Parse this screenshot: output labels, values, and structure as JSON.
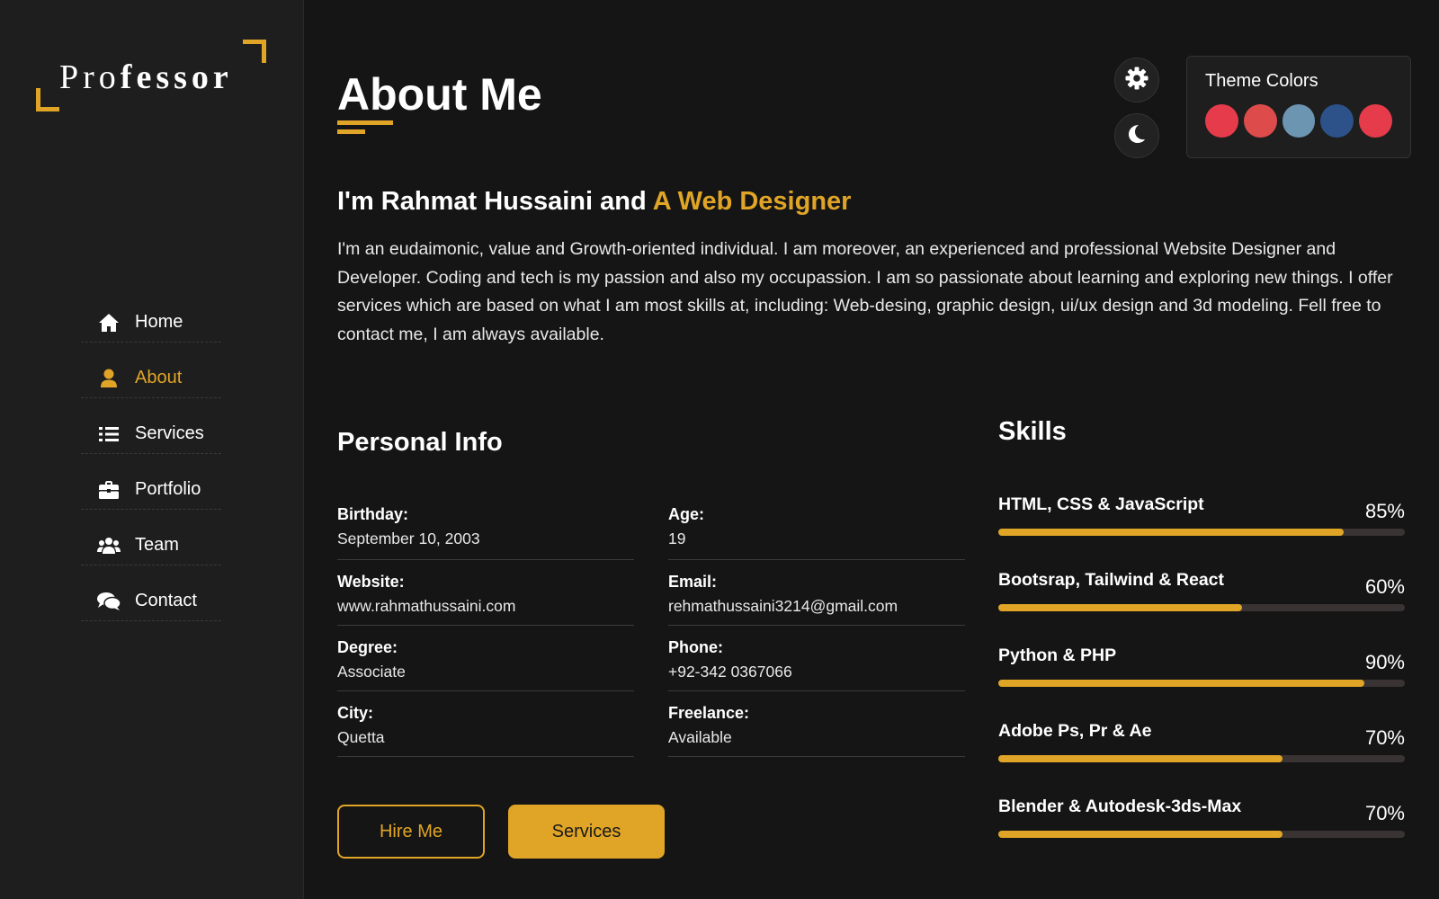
{
  "brand": {
    "logo_light": "Pro",
    "logo_bold": "fessor"
  },
  "nav": [
    {
      "label": "Home",
      "icon": "home-icon",
      "active": false
    },
    {
      "label": "About",
      "icon": "user-icon",
      "active": true
    },
    {
      "label": "Services",
      "icon": "list-icon",
      "active": false
    },
    {
      "label": "Portfolio",
      "icon": "briefcase-icon",
      "active": false
    },
    {
      "label": "Team",
      "icon": "users-icon",
      "active": false
    },
    {
      "label": "Contact",
      "icon": "comments-icon",
      "active": false
    }
  ],
  "header": {
    "title": "About Me"
  },
  "theme": {
    "title": "Theme Colors",
    "swatches": [
      "#e63b4b",
      "#dd4b4b",
      "#6c95b2",
      "#2c5289",
      "#e63b4b"
    ],
    "accent": "#e0a526"
  },
  "intro": {
    "title_prefix": "I'm Rahmat Hussaini and ",
    "title_accent": "A Web Designer",
    "text": "I'm an eudaimonic, value and Growth-oriented individual. I am moreover, an experienced and professional Website Designer and Developer. Coding and tech is my passion and also my occupassion. I am so passionate about learning and exploring new things. I offer services which are based on what I am most skills at, including: Web-desing, graphic design, ui/ux design and 3d modeling. Fell free to contact me, I am always available."
  },
  "personal_info": {
    "title": "Personal Info",
    "fields": [
      {
        "label": "Birthday:",
        "value": "September 10, 2003"
      },
      {
        "label": "Age:",
        "value": "19"
      },
      {
        "label": "Website:",
        "value": "www.rahmathussaini.com"
      },
      {
        "label": "Email:",
        "value": "rehmathussaini3214@gmail.com"
      },
      {
        "label": "Degree:",
        "value": "Associate"
      },
      {
        "label": "Phone:",
        "value": "+92-342 0367066"
      },
      {
        "label": "City:",
        "value": "Quetta"
      },
      {
        "label": "Freelance:",
        "value": "Available"
      }
    ]
  },
  "buttons": {
    "hire": "Hire Me",
    "services": "Services"
  },
  "skills": {
    "title": "Skills",
    "items": [
      {
        "name": "HTML, CSS & JavaScript",
        "percent_label": "85%",
        "percent": 85
      },
      {
        "name": "Bootsrap, Tailwind & React",
        "percent_label": "60%",
        "percent": 60
      },
      {
        "name": "Python & PHP",
        "percent_label": "90%",
        "percent": 90
      },
      {
        "name": "Adobe Ps, Pr & Ae",
        "percent_label": "70%",
        "percent": 70
      },
      {
        "name": "Blender & Autodesk-3ds-Max",
        "percent_label": "70%",
        "percent": 70
      }
    ]
  }
}
